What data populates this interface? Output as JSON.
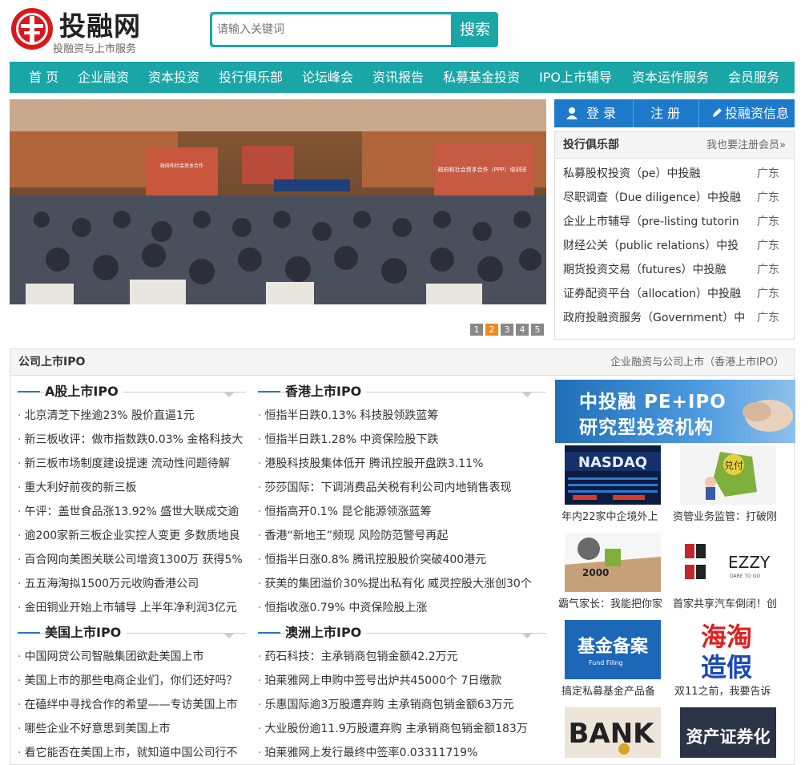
{
  "header": {
    "logo_title": "投融网",
    "logo_subtitle": "投融资与上市服务",
    "search_placeholder": "请输入关键词",
    "search_button": "搜索"
  },
  "nav": [
    "首 页",
    "企业融资",
    "资本投资",
    "投行俱乐部",
    "论坛峰会",
    "资讯报告",
    "私募基金投资",
    "IPO上市辅导",
    "资本运作服务",
    "会员服务"
  ],
  "banner": {
    "slide_title": "政府和社会资本合作（PPP）培训班",
    "pages": [
      "1",
      "2",
      "3",
      "4",
      "5"
    ],
    "active_page": "2"
  },
  "login_bar": {
    "login": "登 录",
    "register": "注 册",
    "info": "投融资信息"
  },
  "club": {
    "title": "投行俱乐部",
    "more": "我也要注册会员»",
    "items": [
      {
        "text": "私募股权投资（pe）中投融",
        "region": "广东"
      },
      {
        "text": "尽职调查（Due diligence）中投融",
        "region": "广东"
      },
      {
        "text": "企业上市辅导（pre-listing tutorin",
        "region": "广东"
      },
      {
        "text": "财经公关（public relations）中投",
        "region": "广东"
      },
      {
        "text": "期货投资交易（futures）中投融",
        "region": "广东"
      },
      {
        "text": "证券配资平台（allocation）中投融",
        "region": "广东"
      },
      {
        "text": "政府投融资服务（Government）中",
        "region": "广东"
      }
    ]
  },
  "ipo": {
    "title": "公司上市IPO",
    "more": "企业融资与公司上市（香港上市IPO）",
    "sections": [
      {
        "title": "A股上市IPO",
        "items": [
          "北京清芝下挫逾23% 股价直逼1元",
          "新三板收评：做市指数跌0.03% 金格科技大",
          "新三板市场制度建设提速 流动性问题待解",
          "重大利好前夜的新三板",
          "午评：盖世食品涨13.92% 盛世大联成交逾",
          "逾200家新三板企业实控人变更 多数质地良",
          "百合网向美图关联公司增资1300万 获得5%",
          "五五海淘拟1500万元收购香港公司",
          "金田铜业开始上市辅导 上半年净利润3亿元"
        ]
      },
      {
        "title": "香港上市IPO",
        "items": [
          "恒指半日跌0.13% 科技股领跌蓝筹",
          "恒指半日跌1.28% 中资保险股下跌",
          "港股科技股集体低开 腾讯控股开盘跌3.11%",
          "莎莎国际：下调消费品关税有利公司内地销售表现",
          "恒指高开0.1% 昆仑能源领涨蓝筹",
          "香港“新地王”频现 风险防范警号再起",
          "恒指半日涨0.8% 腾讯控股股价突破400港元",
          "获美的集团溢价30%提出私有化 威灵控股大涨创30个",
          "恒指收涨0.79% 中资保险股上涨"
        ]
      },
      {
        "title": "美国上市IPO",
        "items": [
          "中国网贷公司智融集团欲赴美国上市",
          "美国上市的那些电商企业们，你们还好吗？",
          "在磕绊中寻找合作的希望——专访美国上市",
          "哪些企业不好意思到美国上市",
          "看它能否在美国上市，就知道中国公司行不"
        ]
      },
      {
        "title": "澳洲上市IPO",
        "items": [
          "药石科技：主承销商包销金额42.2万元",
          "珀莱雅网上申购中签号出炉共45000个 7日缴款",
          "乐惠国际逾3万股遭弃购 主承销商包销金额63万元",
          "大业股份逾11.9万股遭弃购 主承销商包销金额183万",
          "珀莱雅网上发行最终中签率0.03311719%"
        ]
      }
    ]
  },
  "ad": {
    "line1": "中投融  PE+IPO",
    "line2": "研究型投资机构"
  },
  "thumbs": [
    {
      "caption": "年内22家中企境外上",
      "label": "NASDAQ"
    },
    {
      "caption": "资管业务监管：打破刚",
      "label": "兑付"
    },
    {
      "caption": "霸气家长：我能把你家",
      "label": "2000"
    },
    {
      "caption": "首家共享汽车倒闭！创",
      "label": "EZZY",
      "sub": "DARE TO GO"
    },
    {
      "caption": "搞定私募基金产品备",
      "label": "基金备案",
      "sub": "Fund Filing"
    },
    {
      "caption": "双11之前，我要告诉",
      "label": "海淘",
      "label2": "造假"
    },
    {
      "caption": "",
      "label": "BANK"
    },
    {
      "caption": "",
      "label": "资产证券化"
    }
  ]
}
